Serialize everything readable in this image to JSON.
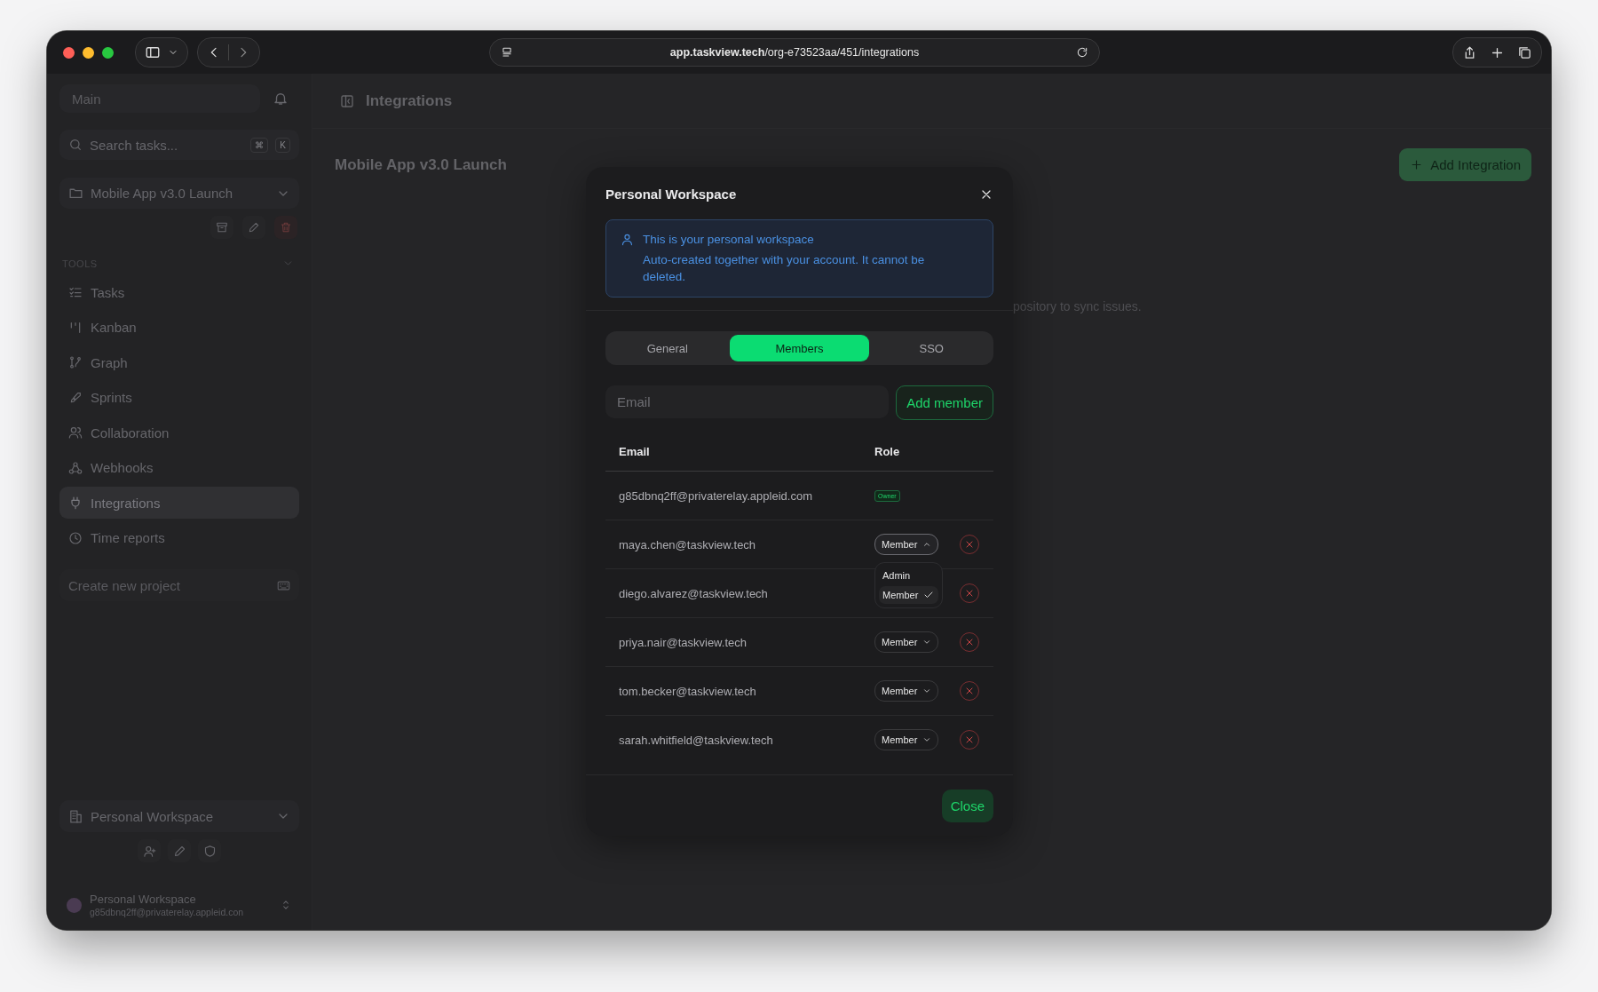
{
  "browser": {
    "url": "**app.taskview.tech**/org-e73523aa/451/integrations"
  },
  "sidebar": {
    "workspace_label": "Main",
    "search": {
      "placeholder": "Search tasks...",
      "keys": [
        "⌘",
        "K"
      ]
    },
    "project": "Mobile App v3.0 Launch",
    "section": "TOOLS",
    "items": [
      {
        "label": "Tasks",
        "selected": false
      },
      {
        "label": "Kanban",
        "selected": false
      },
      {
        "label": "Graph",
        "selected": false
      },
      {
        "label": "Sprints",
        "selected": false
      },
      {
        "label": "Collaboration",
        "selected": false
      },
      {
        "label": "Webhooks",
        "selected": false
      },
      {
        "label": "Integrations",
        "selected": true
      },
      {
        "label": "Time reports",
        "selected": false
      }
    ],
    "create_project": {
      "placeholder": "Create new project"
    },
    "workspace": "Personal Workspace",
    "user": {
      "name": "Personal Workspace",
      "email": "g85dbnq2ff@privaterelay.appleid.con"
    }
  },
  "main": {
    "title": "Integrations",
    "project_title": "Mobile App v3.0 Launch",
    "add_button": "Add Integration",
    "empty_text": "pository to sync issues."
  },
  "modal": {
    "title": "Personal Workspace",
    "notice": {
      "title": "This is your personal workspace",
      "body": "Auto-created together with your account. It cannot be deleted."
    },
    "tabs": [
      {
        "label": "General",
        "selected": false
      },
      {
        "label": "Members",
        "selected": true
      },
      {
        "label": "SSO",
        "selected": false
      }
    ],
    "email_field": {
      "placeholder": "Email"
    },
    "add_button": "Add member",
    "columns": [
      "Email",
      "Role"
    ],
    "members": [
      {
        "email": "g85dbnq2ff@privaterelay.appleid.com",
        "kind": "owner",
        "role": "Owner"
      },
      {
        "email": "maya.chen@taskview.tech",
        "kind": "member",
        "role": "Member",
        "expanded": true,
        "options": [
          {
            "label": "Admin",
            "selected": false
          },
          {
            "label": "Member",
            "selected": true
          }
        ]
      },
      {
        "email": "diego.alvarez@taskview.tech",
        "kind": "member"
      },
      {
        "email": "priya.nair@taskview.tech",
        "kind": "member",
        "role": "Member",
        "expanded": false
      },
      {
        "email": "tom.becker@taskview.tech",
        "kind": "member",
        "role": "Member",
        "expanded": false
      },
      {
        "email": "sarah.whitfield@taskview.tech",
        "kind": "member",
        "role": "Member",
        "expanded": false
      }
    ],
    "close_button": "Close"
  }
}
